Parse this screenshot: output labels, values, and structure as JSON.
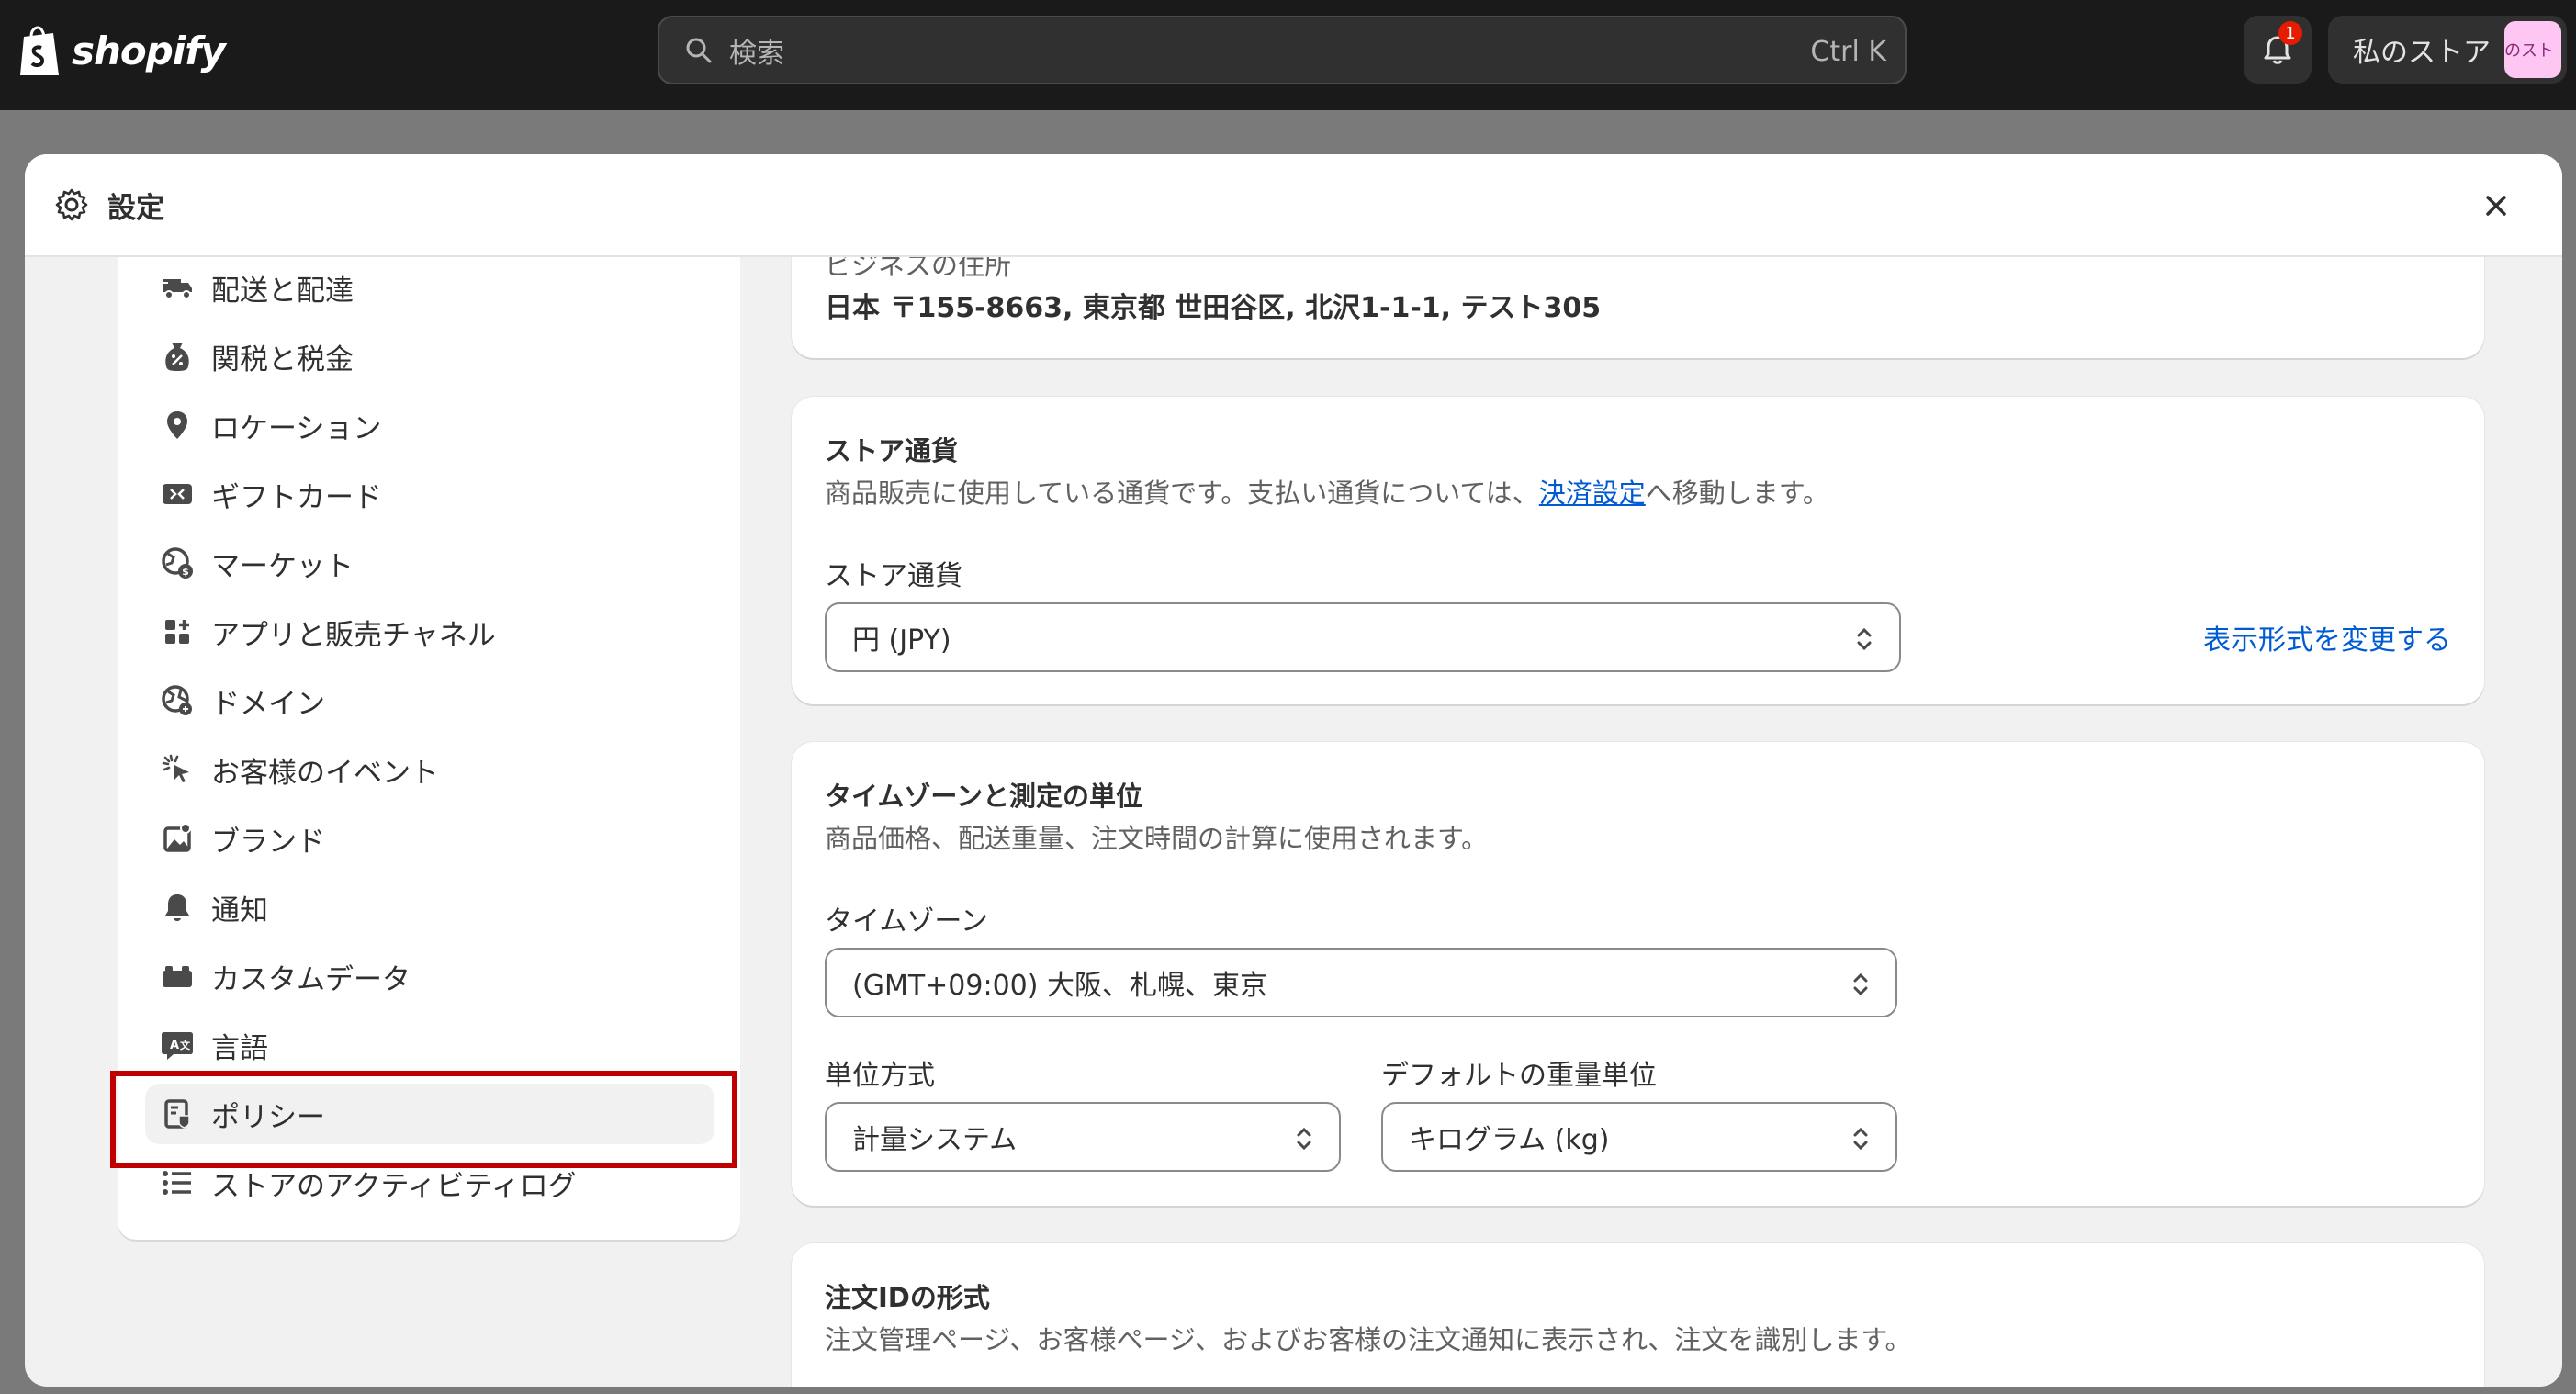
{
  "topbar": {
    "logo_text": "shopify",
    "search_placeholder": "検索",
    "search_shortcut": "Ctrl K",
    "notification_count": "1",
    "store_name": "私のストア",
    "store_avatar_text": "のスト"
  },
  "modal": {
    "title": "設定",
    "close_icon": "close-icon"
  },
  "sidebar": {
    "items": [
      {
        "label": "配送と配達",
        "icon": "truck-icon"
      },
      {
        "label": "関税と税金",
        "icon": "tax-bag-icon"
      },
      {
        "label": "ロケーション",
        "icon": "location-pin-icon"
      },
      {
        "label": "ギフトカード",
        "icon": "gift-card-icon"
      },
      {
        "label": "マーケット",
        "icon": "globe-dollar-icon"
      },
      {
        "label": "アプリと販売チャネル",
        "icon": "apps-icon"
      },
      {
        "label": "ドメイン",
        "icon": "globe-icon"
      },
      {
        "label": "お客様のイベント",
        "icon": "cursor-click-icon"
      },
      {
        "label": "ブランド",
        "icon": "brand-image-icon"
      },
      {
        "label": "通知",
        "icon": "bell-icon"
      },
      {
        "label": "カスタムデータ",
        "icon": "custom-data-icon"
      },
      {
        "label": "言語",
        "icon": "language-icon"
      },
      {
        "label": "ポリシー",
        "icon": "policy-icon"
      },
      {
        "label": "ストアのアクティビティログ",
        "icon": "list-icon"
      }
    ],
    "active_item": "ポリシー"
  },
  "address_card": {
    "partial_label": "ビジネスの住所",
    "address": "日本 〒155-8663, 東京都 世田谷区, 北沢1-1-1, テスト305"
  },
  "currency_card": {
    "title": "ストア通貨",
    "desc_before": "商品販売に使用している通貨です。支払い通貨については、",
    "desc_link": "決済設定",
    "desc_after": "へ移動します。",
    "field_label": "ストア通貨",
    "value": "円 (JPY)",
    "action": "表示形式を変更する"
  },
  "timezone_card": {
    "title": "タイムゾーンと測定の単位",
    "desc": "商品価格、配送重量、注文時間の計算に使用されます。",
    "timezone_label": "タイムゾーン",
    "timezone_value": "(GMT+09:00) 大阪、札幌、東京",
    "unit_label": "単位方式",
    "unit_value": "計量システム",
    "weight_label": "デフォルトの重量単位",
    "weight_value": "キログラム (kg)"
  },
  "order_id_card": {
    "title": "注文IDの形式",
    "desc": "注文管理ページ、お客様ページ、およびお客様の注文通知に表示され、注文を識別します。"
  },
  "colors": {
    "topbar_bg": "#1a1a1a",
    "modal_bg": "#f1f1f1",
    "card_bg": "#ffffff",
    "link": "#005bd3",
    "highlight_border": "#c00000",
    "badge": "#e51c00"
  }
}
